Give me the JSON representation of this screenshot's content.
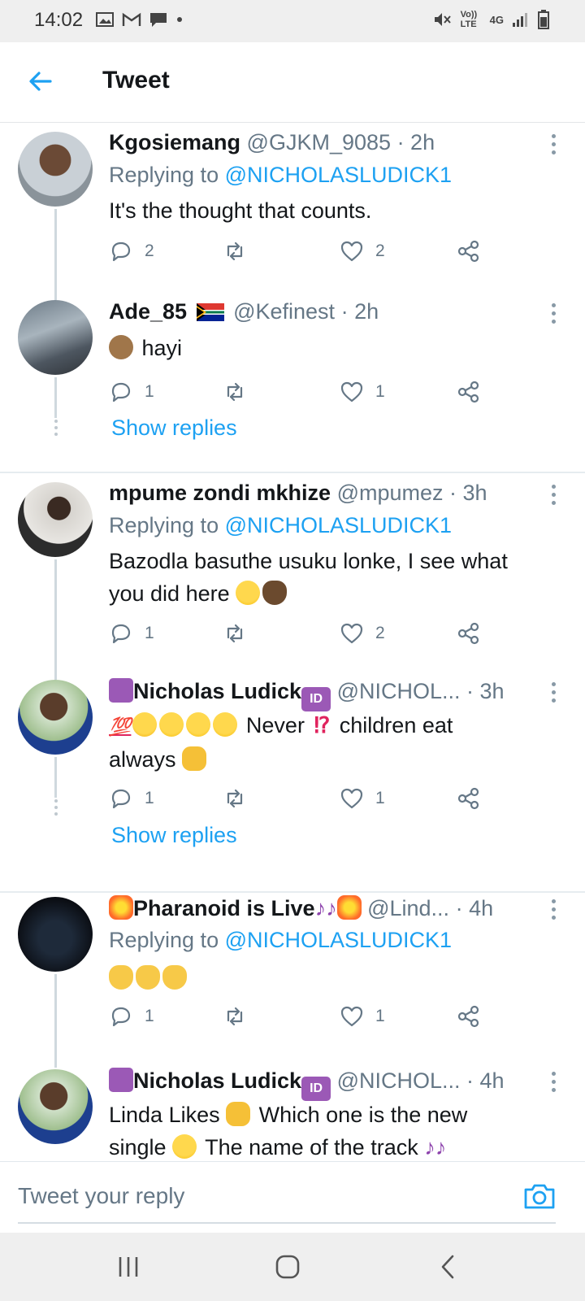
{
  "status_bar": {
    "time": "14:02",
    "left_icons": [
      "image-icon",
      "gmail-icon",
      "message-icon",
      "dot-icon"
    ],
    "right_icons": [
      "mute-icon",
      "volte-icon",
      "4g-icon",
      "signal-icon",
      "battery-icon"
    ],
    "volte_label": "Vo)) LTE",
    "network_label": "4G"
  },
  "header": {
    "title": "Tweet"
  },
  "tweets": [
    {
      "name": "Kgosiemang",
      "handle": "@GJKM_9085",
      "time": "· 2h",
      "replying_prefix": "Replying to ",
      "replying_mention": "@NICHOLASLUDICK1",
      "text": "It's the thought that counts.",
      "replies": "2",
      "retweets": "",
      "likes": "2"
    },
    {
      "name": "Ade_85",
      "handle": "@Kefinest",
      "time": "· 2h",
      "text": "hayi",
      "replies": "1",
      "retweets": "",
      "likes": "1",
      "show_replies": "Show replies"
    },
    {
      "name": "mpume zondi mkhize",
      "handle": "@mpumez",
      "time": "· 3h",
      "replying_prefix": "Replying to ",
      "replying_mention": "@NICHOLASLUDICK1",
      "text_line1": "Bazodla basuthe usuku lonke, I see what",
      "text_line2": "you did here",
      "replies": "1",
      "retweets": "",
      "likes": "2"
    },
    {
      "name": "Nicholas Ludick",
      "handle": "@NICHOL...",
      "time": "· 3h",
      "text_never": "Never",
      "text_rest": "children eat",
      "text_line2": "always",
      "replies": "1",
      "retweets": "",
      "likes": "1",
      "show_replies": "Show replies"
    },
    {
      "name": "Pharanoid is Live",
      "handle": "@Lind...",
      "time": "· 4h",
      "replying_prefix": "Replying to ",
      "replying_mention": "@NICHOLASLUDICK1",
      "replies": "1",
      "retweets": "",
      "likes": "1"
    },
    {
      "name": "Nicholas Ludick",
      "handle": "@NICHOL...",
      "time": "· 4h",
      "text_a": "Linda Likes",
      "text_b": "Which one is the new",
      "text_line2": "single",
      "text_line2b": "The name of the track"
    }
  ],
  "emoji_text": {
    "hundred": "💯",
    "id": "ID",
    "excl": "⁉"
  },
  "reply_bar": {
    "placeholder": "Tweet your reply"
  },
  "colors": {
    "accent": "#1da1f2",
    "muted": "#657786",
    "text": "#14171a"
  }
}
